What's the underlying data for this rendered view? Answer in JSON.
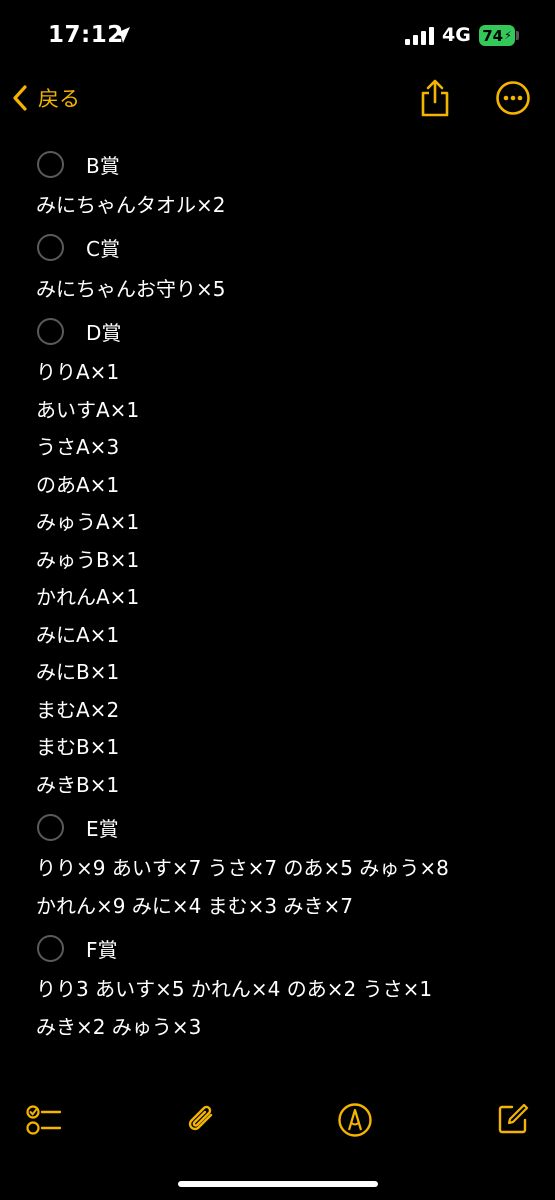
{
  "status": {
    "time": "17:12",
    "network": "4G",
    "battery": "74"
  },
  "nav": {
    "back_label": "戻る"
  },
  "prizes": [
    {
      "title": "B賞",
      "lines": [
        "みにちゃんタオル×2"
      ]
    },
    {
      "title": "C賞",
      "lines": [
        "みにちゃんお守り×5"
      ]
    },
    {
      "title": "D賞",
      "lines": [
        "りりA×1",
        "あいすA×1",
        "うさA×3",
        "のあA×1",
        "みゅうA×1",
        "みゅうB×1",
        "かれんA×1",
        "みにA×1",
        "みにB×1",
        "まむA×2",
        "まむB×1",
        "みきB×1"
      ]
    },
    {
      "title": "E賞",
      "lines": [
        "りり×9 あいす×7 うさ×7 のあ×5 みゅう×8",
        "かれん×9 みに×4 まむ×3  みき×7"
      ]
    },
    {
      "title": "F賞",
      "lines": [
        "りり3 あいす×5 かれん×4 のあ×2 うさ×1",
        "みき×2 みゅう×3"
      ]
    }
  ],
  "colors": {
    "accent": "#f5b400",
    "battery": "#34c759",
    "background": "#000000"
  },
  "toolbar_icons": [
    "checklist-icon",
    "paperclip-icon",
    "markup-pen-icon",
    "compose-icon"
  ]
}
